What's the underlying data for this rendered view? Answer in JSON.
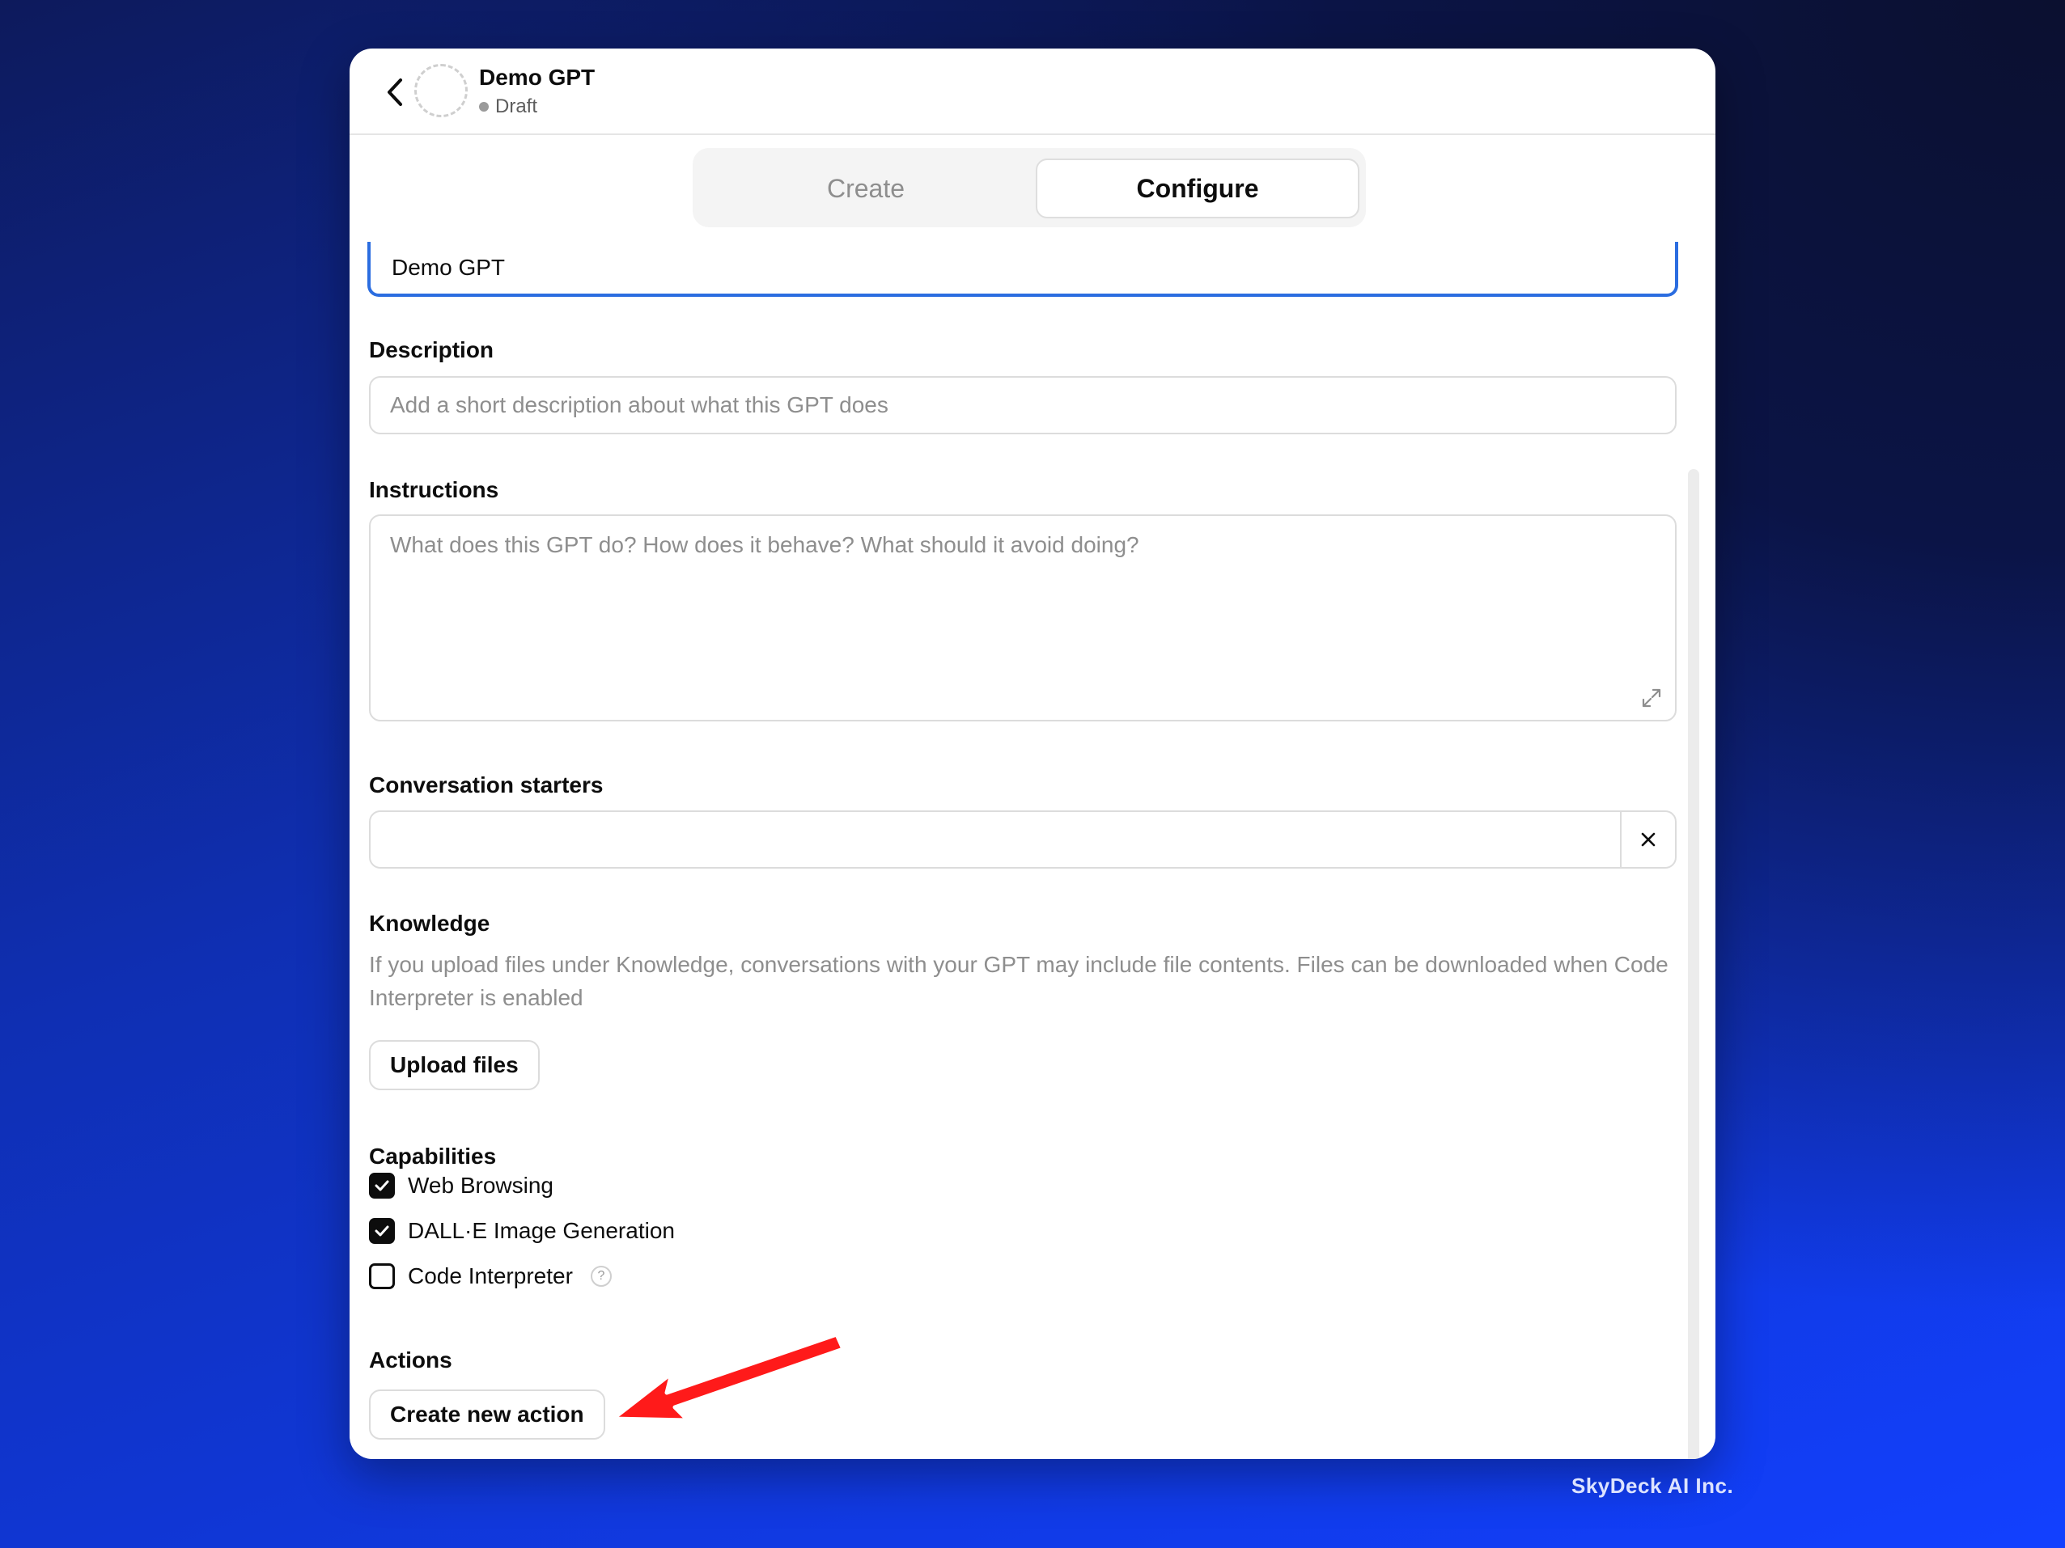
{
  "header": {
    "gpt_name": "Demo GPT",
    "status": "Draft"
  },
  "tabs": [
    {
      "label": "Create",
      "active": false
    },
    {
      "label": "Configure",
      "active": true
    }
  ],
  "form": {
    "name_value": "Demo GPT",
    "description_label": "Description",
    "description_placeholder": "Add a short description about what this GPT does",
    "instructions_label": "Instructions",
    "instructions_placeholder": "What does this GPT do? How does it behave? What should it avoid doing?",
    "starters_label": "Conversation starters",
    "knowledge_label": "Knowledge",
    "knowledge_help": "If you upload files under Knowledge, conversations with your GPT may include file contents. Files can be downloaded when Code Interpreter is enabled",
    "upload_label": "Upload files",
    "capabilities_label": "Capabilities",
    "capabilities": [
      {
        "label": "Web Browsing",
        "checked": true
      },
      {
        "label": "DALL·E Image Generation",
        "checked": true
      },
      {
        "label": "Code Interpreter",
        "checked": false
      }
    ],
    "help_glyph": "?",
    "actions_label": "Actions",
    "create_action_label": "Create new action"
  },
  "footer": "SkyDeck AI Inc.",
  "colors": {
    "accent_border": "#2b6de0",
    "arrow": "#ff1a1a"
  },
  "icons": {
    "back": "chevron-left-icon",
    "expand": "expand-icon",
    "close": "close-icon",
    "check": "checkmark-icon",
    "help": "help-circle-icon"
  }
}
